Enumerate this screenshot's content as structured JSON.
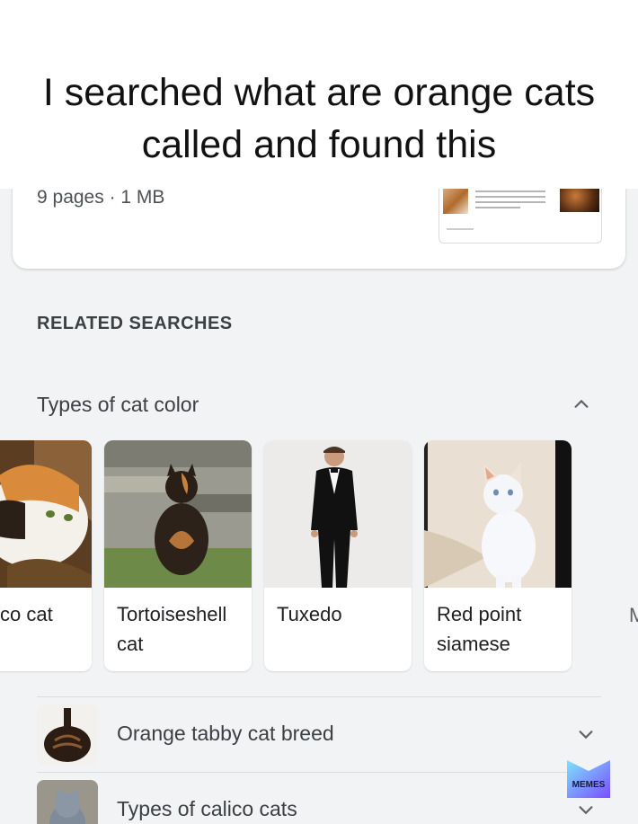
{
  "caption": {
    "line1": "I searched what are orange cats",
    "line2": "called and found this"
  },
  "result": {
    "meta": "9 pages · 1 MB",
    "thumb_icon": "document-preview-thumbnail"
  },
  "related": {
    "title": "RELATED SEARCHES",
    "group_label": "Types of cat color",
    "group_expanded": true,
    "tiles": [
      {
        "line1": "co cat",
        "line2": "",
        "image": "calico-cat-photo"
      },
      {
        "line1": "Tortoiseshell",
        "line2": "cat",
        "image": "tortoiseshell-cat-photo"
      },
      {
        "line1": "Tuxedo",
        "line2": "",
        "image": "man-in-tuxedo-photo"
      },
      {
        "line1": "Red point",
        "line2": "siamese",
        "image": "red-point-siamese-photo"
      }
    ],
    "next_tile_peek": "M",
    "rows": [
      {
        "label": "Orange tabby cat breed",
        "icon": "chevron-down-icon"
      },
      {
        "label": "Types of calico cats",
        "icon": "chevron-down-icon"
      }
    ]
  },
  "watermark": {
    "text": "MEMES"
  },
  "colors": {
    "accent": "#4285f4",
    "card": "#ffffff",
    "background": "#f1f3f4"
  }
}
